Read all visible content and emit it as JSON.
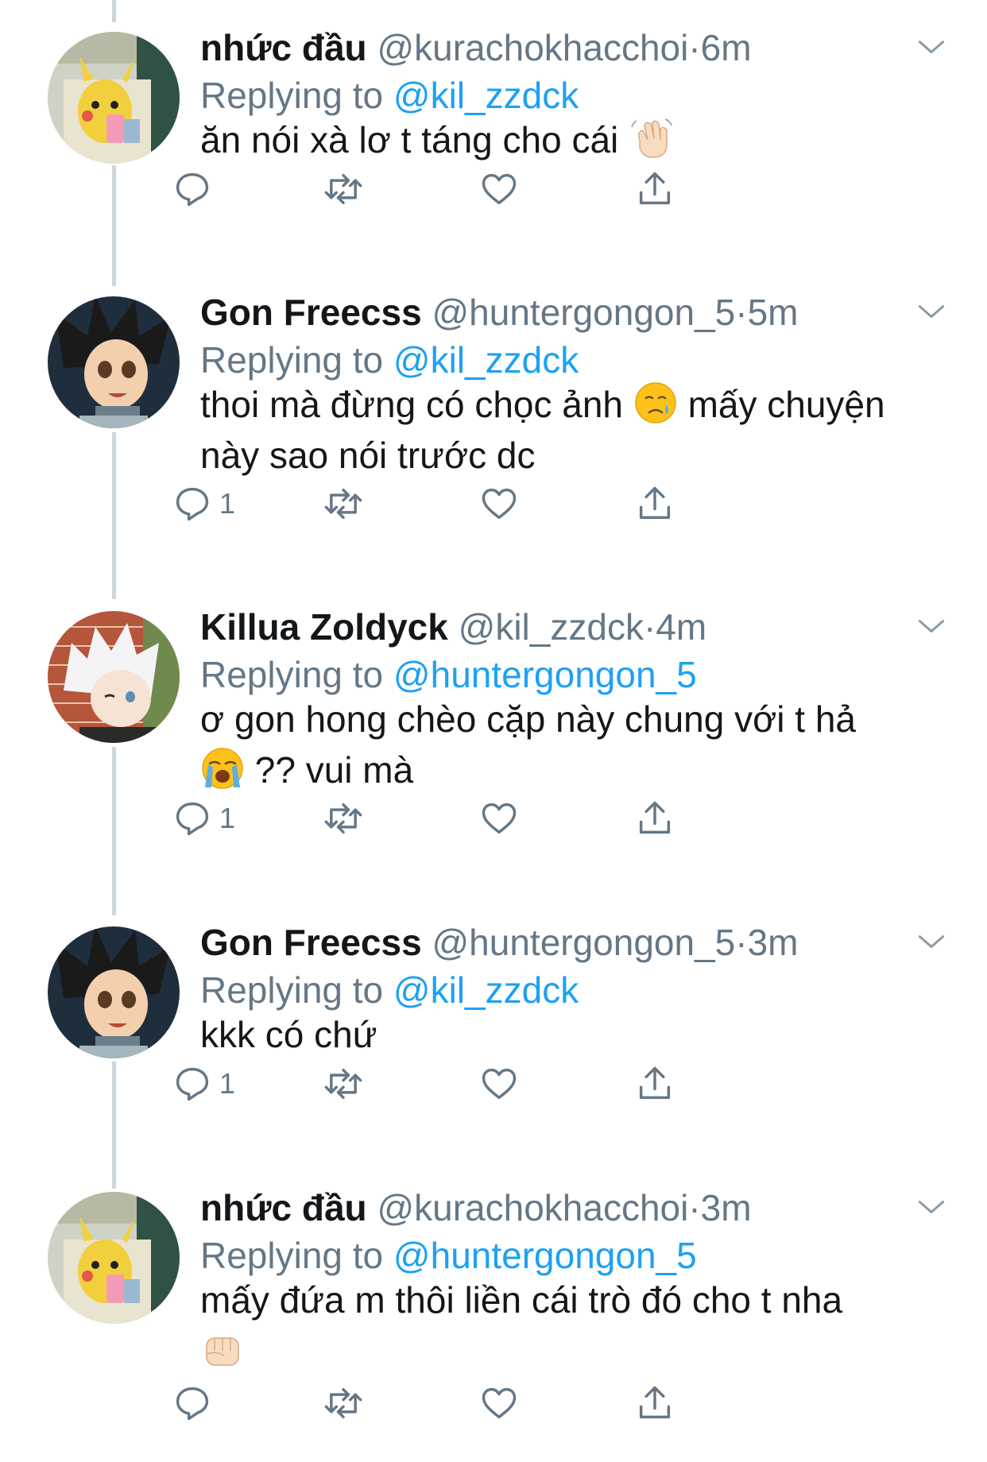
{
  "tweets": [
    {
      "name": "nhức đầu",
      "handle": "@kurachokhacchoi",
      "separator": "·",
      "time": "6m",
      "replying_label": "Replying to",
      "reply_to": "@kil_zzdck",
      "text": "ăn nói xà lơ t táng cho cái",
      "text_end": "",
      "emoji": "waving-hand-icon",
      "reply_count": "",
      "avatar": "pikachu-avatar"
    },
    {
      "name": "Gon Freecss",
      "handle": "@huntergongon_5",
      "separator": "·",
      "time": "5m",
      "replying_label": "Replying to",
      "reply_to": "@kil_zzdck",
      "text": "thoi mà đừng có chọc ảnh",
      "text_end": "mấy chuyện này sao nói trước dc",
      "emoji": "crying-face-icon",
      "reply_count": "1",
      "avatar": "gon-avatar"
    },
    {
      "name": "Killua Zoldyck",
      "handle": "@kil_zzdck",
      "separator": "·",
      "time": "4m",
      "replying_label": "Replying to",
      "reply_to": "@huntergongon_5",
      "text": "ơ gon hong chèo cặp này chung với t hả",
      "text_end": "?? vui mà",
      "emoji": "loudly-crying-face-icon",
      "reply_count": "1",
      "avatar": "killua-avatar"
    },
    {
      "name": "Gon Freecss",
      "handle": "@huntergongon_5",
      "separator": "·",
      "time": "3m",
      "replying_label": "Replying to",
      "reply_to": "@kil_zzdck",
      "text": "kkk có chứ",
      "text_end": "",
      "emoji": "",
      "reply_count": "1",
      "avatar": "gon-avatar"
    },
    {
      "name": "nhức đầu",
      "handle": "@kurachokhacchoi",
      "separator": "·",
      "time": "3m",
      "replying_label": "Replying to",
      "reply_to": "@huntergongon_5",
      "text": "mấy đứa m thôi liền cái trò đó cho t nha",
      "text_end": "",
      "emoji": "fist-icon",
      "reply_count": "",
      "avatar": "pikachu-avatar"
    }
  ],
  "colors": {
    "link": "#1da1f2",
    "secondary": "#657786",
    "thread_line": "#ccd6dd"
  }
}
